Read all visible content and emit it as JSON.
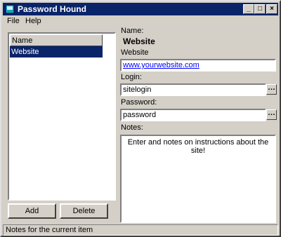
{
  "window": {
    "title": "Password Hound"
  },
  "menu": {
    "file": "File",
    "help": "Help"
  },
  "list": {
    "header": "Name",
    "items": [
      "Website"
    ]
  },
  "buttons": {
    "add": "Add",
    "delete": "Delete"
  },
  "form": {
    "name_label": "Name:",
    "name_value": "Website",
    "website_label": "Website",
    "website_value": "www.yourwebsite.com",
    "login_label": "Login:",
    "login_value": "sitelogin",
    "password_label": "Password:",
    "password_value": "password",
    "notes_label": "Notes:",
    "notes_value": "Enter and notes on instructions about the site!"
  },
  "statusbar": {
    "text": "Notes for the current item"
  },
  "colors": {
    "titlebar": "#0a246a",
    "face": "#d4d0c8",
    "link": "#0000ff"
  }
}
